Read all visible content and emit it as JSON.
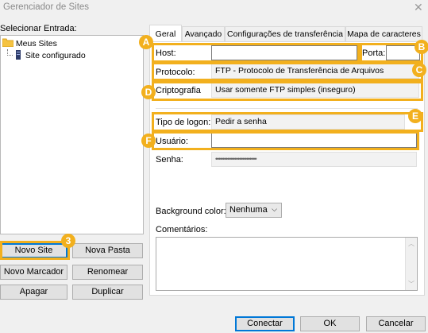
{
  "window": {
    "title": "Gerenciador de Sites",
    "close_symbol": "✕"
  },
  "left": {
    "label": "Selecionar Entrada:",
    "tree": {
      "root": "Meus Sites",
      "child": "Site configurado"
    },
    "buttons": {
      "new_site": "Novo Site",
      "new_folder": "Nova Pasta",
      "new_bookmark": "Novo Marcador",
      "rename": "Renomear",
      "delete": "Apagar",
      "duplicate": "Duplicar"
    }
  },
  "tabs": [
    {
      "label": "Geral"
    },
    {
      "label": "Avançado"
    },
    {
      "label": "Configurações de transferência"
    },
    {
      "label": "Mapa de caracteres"
    }
  ],
  "general": {
    "host_label": "Host:",
    "host_value": "",
    "port_label": "Porta:",
    "port_value": "",
    "protocol_label": "Protocolo:",
    "protocol_value": "FTP - Protocolo de Transferência de Arquivos",
    "encryption_label": "Criptografia",
    "encryption_value": "Usar somente FTP simples (inseguro)",
    "logon_label": "Tipo de logon:",
    "logon_value": "Pedir a senha",
    "user_label": "Usuário:",
    "user_value": "",
    "password_label": "Senha:",
    "password_value": "••••••••••••••••••••••••",
    "bg_color_label": "Background color:",
    "bg_color_value": "Nenhuma",
    "comments_label": "Comentários:"
  },
  "dialog_buttons": {
    "connect": "Conectar",
    "ok": "OK",
    "cancel": "Cancelar"
  },
  "annotations": [
    "A",
    "B",
    "C",
    "D",
    "E",
    "F",
    "3"
  ],
  "colors": {
    "highlight": "#f2b01e",
    "focus": "#0078d7"
  }
}
